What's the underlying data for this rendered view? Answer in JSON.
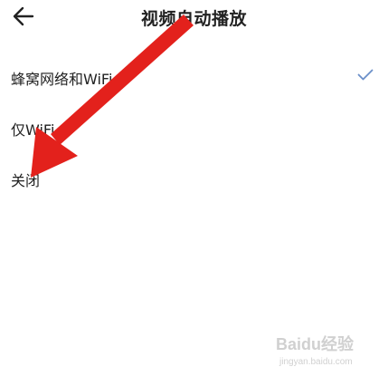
{
  "header": {
    "title": "视频自动播放",
    "back_icon": "arrow-left-icon"
  },
  "options": [
    {
      "label": "蜂窝网络和WiFi",
      "selected": true
    },
    {
      "label": "仅WiFi",
      "selected": false
    },
    {
      "label": "关闭",
      "selected": false
    }
  ],
  "colors": {
    "check": "#6b8fc9",
    "arrow": "#e3211c",
    "text": "#222222"
  },
  "watermark": {
    "text": "Baidu经验",
    "sub": "jingyan.baidu.com"
  }
}
